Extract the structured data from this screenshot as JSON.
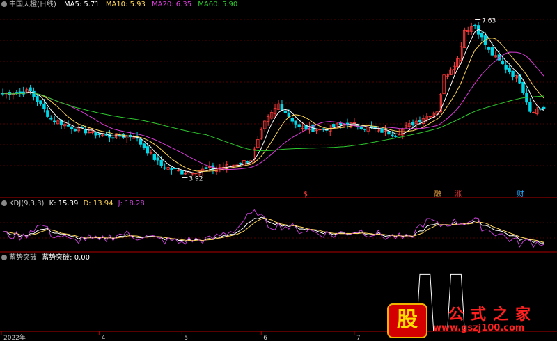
{
  "colors": {
    "up": "#ff3b3b",
    "down": "#00d8e8",
    "ma5": "#ffffff",
    "ma10": "#ffd75a",
    "ma20": "#d63cd6",
    "ma60": "#2ec82e",
    "kdj_k": "#ffffff",
    "kdj_d": "#ffd75a",
    "kdj_j": "#c040d0",
    "grid": "#5a0000",
    "sep": "#b00000"
  },
  "header": {
    "title": "中国天楹(日线)",
    "ma5": "MA5: 5.71",
    "ma10": "MA10: 5.93",
    "ma20": "MA20: 6.35",
    "ma60": "MA60: 5.90"
  },
  "kdj_header": {
    "name": "KDJ(9,3,3)",
    "k": "K: 15.39",
    "d": "D: 13.94",
    "j": "J: 18.28"
  },
  "indicator_header": {
    "name": "蓄势突破",
    "value": "蓄势突破: 0.00"
  },
  "watermark": {
    "logo_char": "股",
    "name": "公式之家",
    "url": "www.gszj100.com"
  },
  "chart_data": [
    {
      "type": "candlestick",
      "title": "中国天楹(日线)",
      "ylim": [
        3.6,
        7.9
      ],
      "x_ticks": [
        "2022年",
        "4",
        "5",
        "6",
        "7"
      ],
      "annotations": [
        {
          "label": "7.63",
          "value": 7.63
        },
        {
          "label": "3.92",
          "value": 3.92
        }
      ],
      "event_markers": [
        {
          "label": "$",
          "color": "#ff3b3b"
        },
        {
          "label": "融",
          "color": "#e8a040"
        },
        {
          "label": "涨",
          "color": "#ff3b3b"
        },
        {
          "label": "财",
          "color": "#20a8ff"
        }
      ],
      "price_knots": [
        [
          0,
          5.9
        ],
        [
          8,
          5.95
        ],
        [
          14,
          5.3
        ],
        [
          20,
          5.1
        ],
        [
          30,
          4.9
        ],
        [
          38,
          4.9
        ],
        [
          46,
          4.2
        ],
        [
          52,
          4.05
        ],
        [
          58,
          4.1
        ],
        [
          66,
          4.2
        ],
        [
          72,
          4.35
        ],
        [
          76,
          5.2
        ],
        [
          80,
          5.65
        ],
        [
          86,
          5.1
        ],
        [
          92,
          5.05
        ],
        [
          100,
          5.2
        ],
        [
          108,
          5.05
        ],
        [
          114,
          4.95
        ],
        [
          120,
          5.25
        ],
        [
          126,
          5.5
        ],
        [
          128,
          6.3
        ],
        [
          132,
          6.7
        ],
        [
          134,
          7.4
        ],
        [
          137,
          7.5
        ],
        [
          141,
          6.9
        ],
        [
          146,
          6.5
        ],
        [
          150,
          6.2
        ],
        [
          153,
          5.5
        ],
        [
          157,
          5.55
        ]
      ],
      "series": [
        {
          "name": "MA5"
        },
        {
          "name": "MA10"
        },
        {
          "name": "MA20"
        },
        {
          "name": "MA60"
        }
      ]
    },
    {
      "type": "line",
      "title": "KDJ(9,3,3)",
      "ylim": [
        -10,
        120
      ],
      "k_knots": [
        [
          0,
          45
        ],
        [
          6,
          35
        ],
        [
          12,
          55
        ],
        [
          20,
          30
        ],
        [
          28,
          25
        ],
        [
          36,
          35
        ],
        [
          44,
          30
        ],
        [
          52,
          20
        ],
        [
          60,
          22
        ],
        [
          68,
          45
        ],
        [
          74,
          90
        ],
        [
          80,
          70
        ],
        [
          88,
          55
        ],
        [
          96,
          40
        ],
        [
          104,
          45
        ],
        [
          112,
          35
        ],
        [
          118,
          30
        ],
        [
          124,
          65
        ],
        [
          130,
          70
        ],
        [
          138,
          75
        ],
        [
          144,
          50
        ],
        [
          150,
          25
        ],
        [
          157,
          15
        ]
      ],
      "series": [
        {
          "name": "K"
        },
        {
          "name": "D"
        },
        {
          "name": "J"
        }
      ]
    },
    {
      "type": "line",
      "title": "蓄势突破",
      "ylim": [
        0,
        1.2
      ],
      "pulses": [
        {
          "start": 121,
          "end": 124
        },
        {
          "start": 130,
          "end": 133
        }
      ],
      "series": [
        {
          "name": "蓄势突破"
        }
      ]
    }
  ]
}
